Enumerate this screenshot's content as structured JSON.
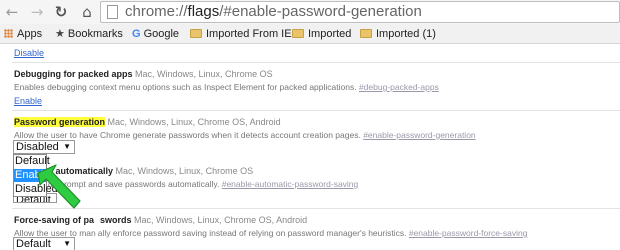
{
  "toolbar": {
    "url_scheme": "chrome://",
    "url_host": "flags",
    "url_path": "/#enable-password-generation"
  },
  "bookmarks": {
    "items": [
      {
        "label": "Apps",
        "icon": "apps-grid-icon"
      },
      {
        "label": "Bookmarks",
        "icon": "star-icon"
      },
      {
        "label": "Google",
        "icon": "google-icon"
      },
      {
        "label": "Imported From IE",
        "icon": "folder-icon"
      },
      {
        "label": "Imported",
        "icon": "folder-icon"
      },
      {
        "label": "Imported (1)",
        "icon": "folder-icon"
      }
    ]
  },
  "flags": {
    "top_link": "Disable",
    "debugging": {
      "title": "Debugging for packed apps",
      "platforms": "Mac, Windows, Linux, Chrome OS",
      "description": "Enables debugging context menu options such as Inspect Element for packed applications.",
      "anchor": "#debug-packed-apps",
      "action": "Enable"
    },
    "password_generation": {
      "title": "Password generation",
      "platforms": "Mac, Windows, Linux, Chrome OS, Android",
      "description": "Allow the user to have Chrome generate passwords when it detects account creation pages.",
      "anchor": "#enable-password-generation",
      "selected": "Disabled",
      "options": [
        "Default",
        "Enabled",
        "Disabled"
      ],
      "highlighted_option": "Enabled"
    },
    "auto_password": {
      "title_visible": "s automatically",
      "platforms": "Mac, Windows, Linux, Chrome OS",
      "description_visible": "ds prompt and save passwords automatically.",
      "anchor": "#enable-automatic-password-saving",
      "selected_partial": "Default"
    },
    "force_saving": {
      "title_visible_a": "Force-saving of pa",
      "title_visible_b": "swords",
      "platforms": "Mac, Windows, Linux, Chrome OS, Android",
      "description_visible_a": "Allow the user to man",
      "description_visible_b": "ally enforce password saving instead of relying on password manager's heuristics.",
      "anchor": "#enable-password-force-saving",
      "selected": "Default"
    }
  },
  "colors": {
    "highlight": "#ffff3c",
    "selected_option": "#1e90ff",
    "link": "#3366cc",
    "annotation_arrow": "#2ecc40"
  }
}
